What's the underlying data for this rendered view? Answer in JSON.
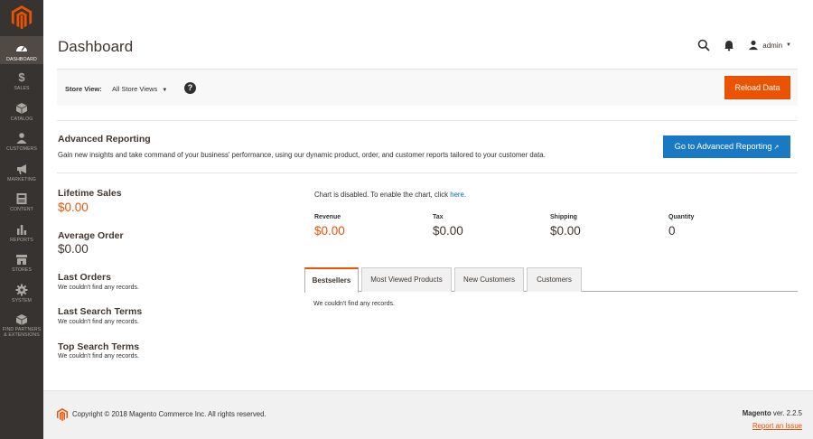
{
  "sidebar": {
    "items": [
      {
        "label": "DASHBOARD",
        "icon": "dashboard-icon"
      },
      {
        "label": "SALES",
        "icon": "dollar-icon"
      },
      {
        "label": "CATALOG",
        "icon": "cube-icon"
      },
      {
        "label": "CUSTOMERS",
        "icon": "users-icon"
      },
      {
        "label": "MARKETING",
        "icon": "megaphone-icon"
      },
      {
        "label": "CONTENT",
        "icon": "content-icon"
      },
      {
        "label": "REPORTS",
        "icon": "bar-chart-icon"
      },
      {
        "label": "STORES",
        "icon": "store-icon"
      },
      {
        "label": "SYSTEM",
        "icon": "gear-icon"
      },
      {
        "label": "FIND PARTNERS",
        "label2": "& EXTENSIONS",
        "icon": "box-icon"
      }
    ]
  },
  "header": {
    "title": "Dashboard",
    "user": "admin"
  },
  "store_bar": {
    "label": "Store View:",
    "selected": "All Store Views",
    "help": "?",
    "reload_label": "Reload Data"
  },
  "advanced": {
    "title": "Advanced Reporting",
    "description": "Gain new insights and take command of your business' performance, using our dynamic product, order, and customer reports tailored to your customer data.",
    "button_label": "Go to Advanced Reporting"
  },
  "stats": {
    "lifetime_sales_title": "Lifetime Sales",
    "lifetime_sales_value": "$0.00",
    "average_order_title": "Average Order",
    "average_order_value": "$0.00",
    "last_orders_title": "Last Orders",
    "last_orders_empty": "We couldn't find any records.",
    "last_search_title": "Last Search Terms",
    "last_search_empty": "We couldn't find any records.",
    "top_search_title": "Top Search Terms",
    "top_search_empty": "We couldn't find any records."
  },
  "chart": {
    "message": "Chart is disabled. To enable the chart, click",
    "link": "here",
    "period": "."
  },
  "totals": [
    {
      "label": "Revenue",
      "value": "$0.00"
    },
    {
      "label": "Tax",
      "value": "$0.00"
    },
    {
      "label": "Shipping",
      "value": "$0.00"
    },
    {
      "label": "Quantity",
      "value": "0"
    }
  ],
  "tabs": {
    "items": [
      "Bestsellers",
      "Most Viewed Products",
      "New Customers",
      "Customers"
    ],
    "active": "Bestsellers",
    "content_empty": "We couldn't find any records."
  },
  "footer": {
    "copyright": "Copyright © 2018 Magento Commerce Inc. All rights reserved.",
    "brand": "Magento",
    "version": " ver. 2.2.5",
    "report_link": "Report an Issue"
  },
  "colors": {
    "sidebar_bg": "#373330",
    "accent": "#eb5202",
    "primary_button": "#1979c3"
  }
}
